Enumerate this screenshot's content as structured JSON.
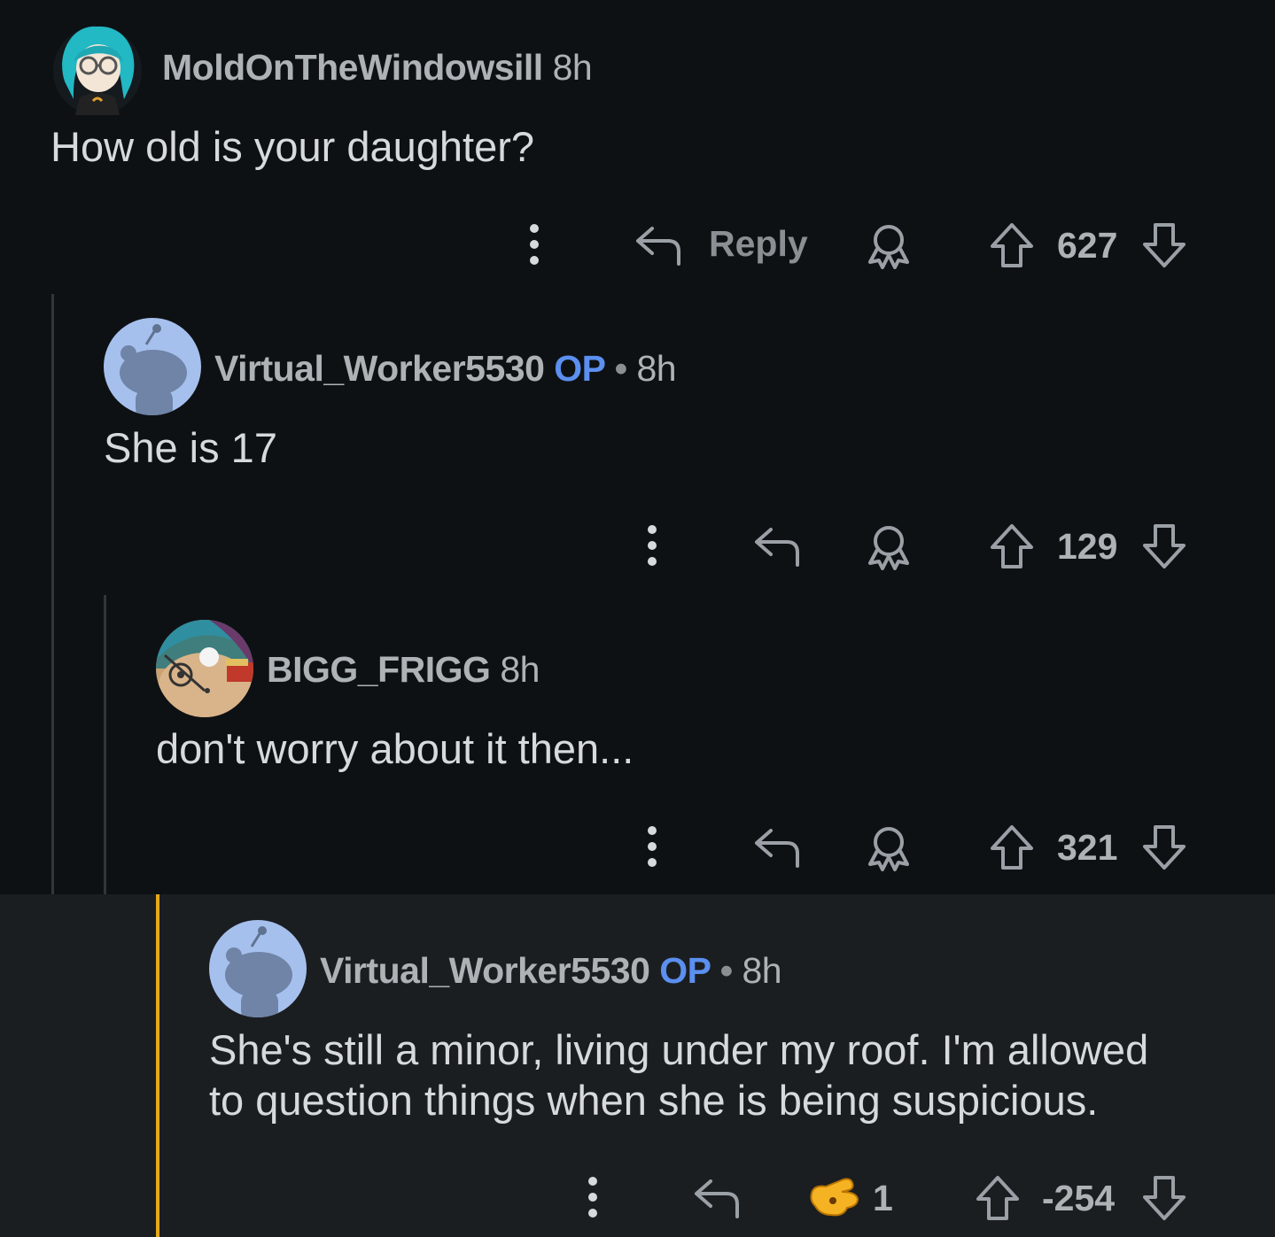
{
  "comments": [
    {
      "username": "MoldOnTheWindowsill",
      "time": "8h",
      "body": "How old is your daughter?",
      "reply_label": "Reply",
      "votes": "627",
      "avatar": "anime-girl-avatar"
    },
    {
      "username": "Virtual_Worker5530",
      "op_badge": "OP",
      "separator": "•",
      "time": "8h",
      "body": "She is 17",
      "votes": "129",
      "avatar": "default-snoo-avatar"
    },
    {
      "username": "BIGG_FRIGG",
      "time": "8h",
      "body": "don't worry about it then...",
      "votes": "321",
      "avatar": "cartoon-character-avatar"
    },
    {
      "username": "Virtual_Worker5530",
      "op_badge": "OP",
      "separator": "•",
      "time": "8h",
      "body_line1": "She's still a minor, living under my roof. I'm allowed",
      "body_line2": "to question things when she is being suspicious.",
      "award_count": "1",
      "votes": "-254",
      "avatar": "default-snoo-avatar",
      "highlight_color": "#e3a91b"
    }
  ],
  "colors": {
    "background": "#0e1114",
    "highlight_background": "#1b1e21",
    "op_badge": "#5b8ff0",
    "text": "#d7dadc",
    "meta_text": "#adb2b6"
  }
}
